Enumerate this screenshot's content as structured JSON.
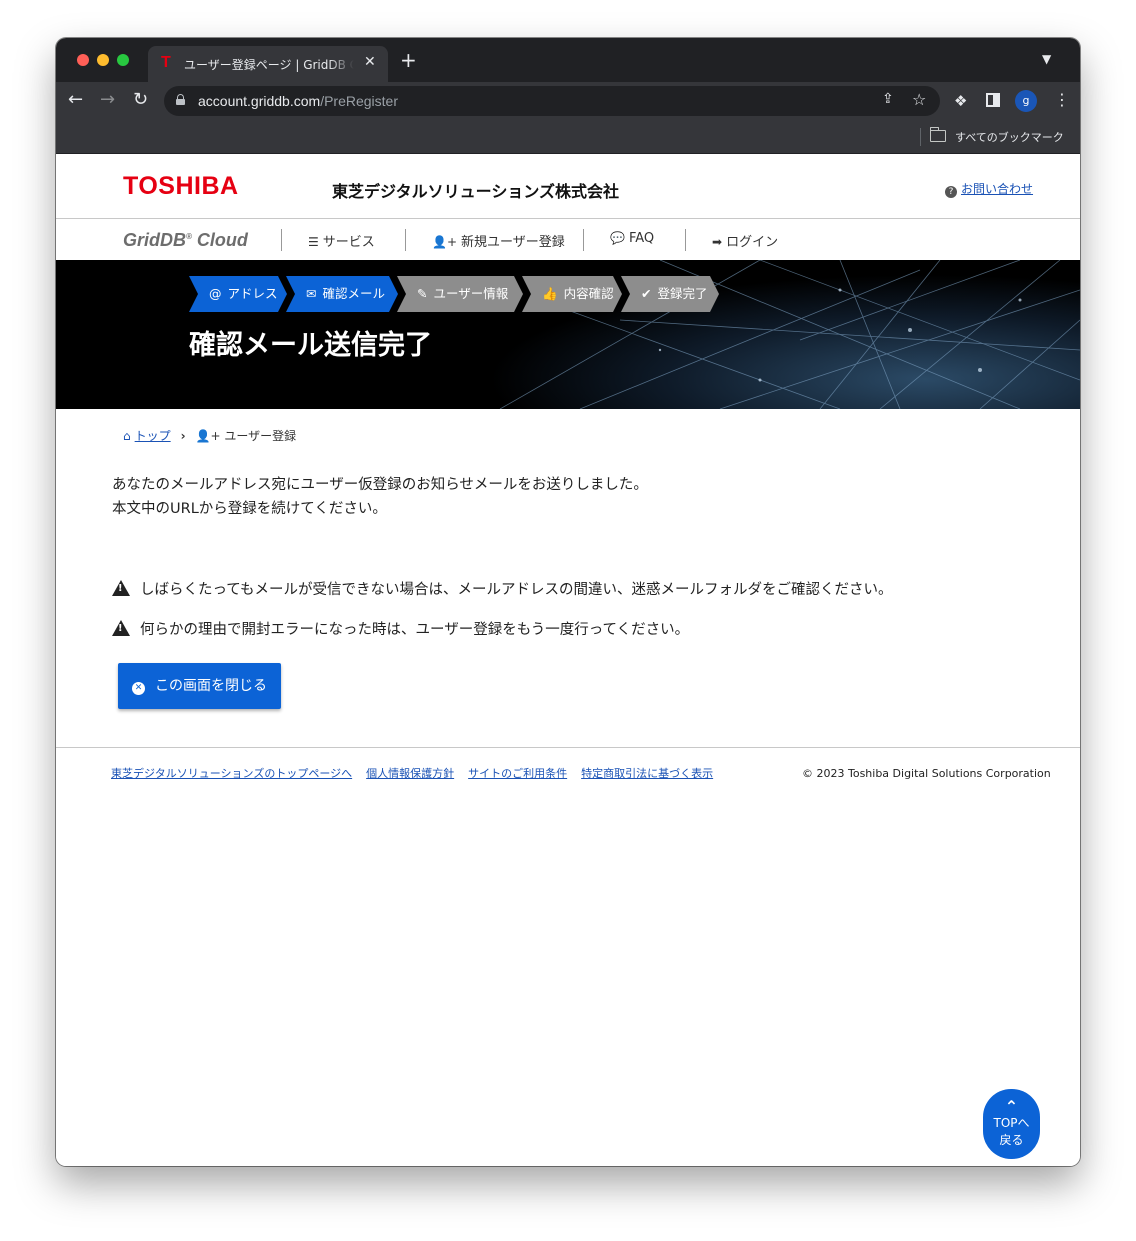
{
  "browser": {
    "tab_title": "ユーザー登録ページ | GridDB Cloud",
    "tab_favicon": "T",
    "tab_close": "✕",
    "new_tab": "+",
    "tab_menu": "⌄",
    "url_host": "account.griddb.com",
    "url_path": "/PreRegister",
    "bookmarks_label": "すべてのブックマーク",
    "profile_initial": "g"
  },
  "header": {
    "logo": "TOSHIBA",
    "company": "東芝デジタルソリューションズ株式会社",
    "contact": "お問い合わせ"
  },
  "nav": {
    "brand": "GridDB",
    "brand_reg": "®",
    "brand_suffix": "Cloud",
    "items": [
      "サービス",
      "新規ユーザー登録",
      "FAQ",
      "ログイン"
    ]
  },
  "steps": [
    {
      "label": "アドレス",
      "icon": "@",
      "active": true
    },
    {
      "label": "確認メール",
      "icon": "✉",
      "active": true
    },
    {
      "label": "ユーザー情報",
      "icon": "✎",
      "active": false
    },
    {
      "label": "内容確認",
      "icon": "👍",
      "active": false
    },
    {
      "label": "登録完了",
      "icon": "✔",
      "active": false
    }
  ],
  "hero_title": "確認メール送信完了",
  "breadcrumb": {
    "top": "トップ",
    "current": "ユーザー登録"
  },
  "message": {
    "line1": "あなたのメールアドレス宛にユーザー仮登録のお知らせメールをお送りしました。",
    "line2": "本文中のURLから登録を続けてください。",
    "warning1": "しばらくたってもメールが受信できない場合は、メールアドレスの間違い、迷惑メールフォルダをご確認ください。",
    "warning2": "何らかの理由で開封エラーになった時は、ユーザー登録をもう一度行ってください。"
  },
  "close_button": "この画面を閉じる",
  "footer": {
    "links": [
      "東芝デジタルソリューションズのトップページへ",
      "個人情報保護方針",
      "サイトのご利用条件",
      "特定商取引法に基づく表示"
    ],
    "copyright": "© 2023 Toshiba Digital Solutions Corporation"
  },
  "top_button": {
    "line1": "TOPへ",
    "line2": "戻る"
  },
  "colors": {
    "accent": "#0c63d6",
    "brand_red": "#e60012",
    "step_inactive": "#8d8d8d"
  }
}
